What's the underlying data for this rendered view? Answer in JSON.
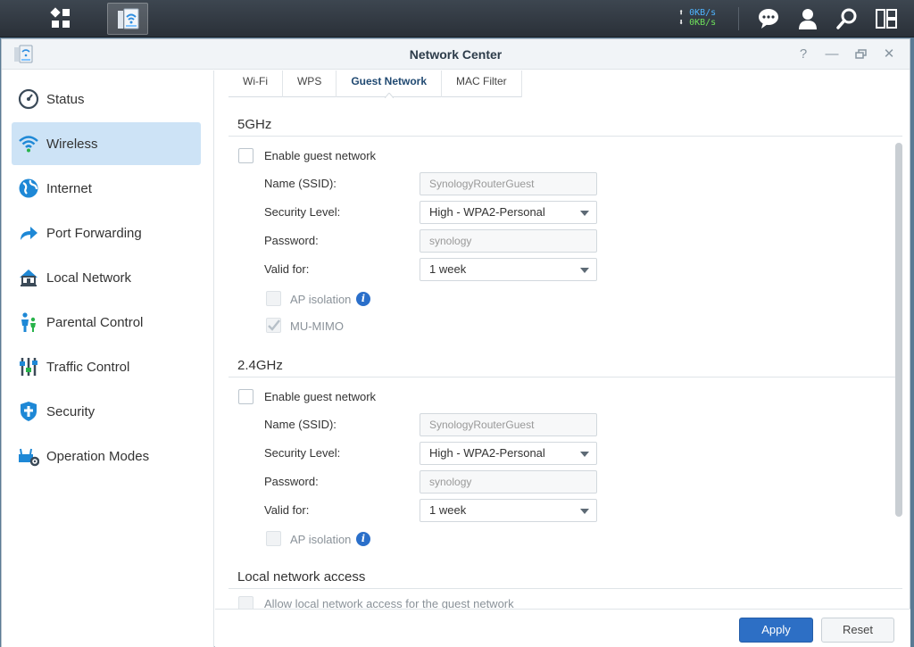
{
  "taskbar": {
    "upload_speed": "0KB/s",
    "download_speed": "0KB/s",
    "icons": [
      "main-menu-icon",
      "network-center-app-icon",
      "chat-icon",
      "user-icon",
      "search-icon",
      "widgets-icon"
    ]
  },
  "window": {
    "title": "Network Center",
    "controls": [
      "help-icon",
      "minimize-icon",
      "restore-icon",
      "close-icon"
    ]
  },
  "sidebar": {
    "items": [
      {
        "label": "Status",
        "icon": "gauge-icon"
      },
      {
        "label": "Wireless",
        "icon": "wifi-icon",
        "active": true
      },
      {
        "label": "Internet",
        "icon": "globe-icon"
      },
      {
        "label": "Port Forwarding",
        "icon": "arrow-forward-icon"
      },
      {
        "label": "Local Network",
        "icon": "home-network-icon"
      },
      {
        "label": "Parental Control",
        "icon": "family-icon"
      },
      {
        "label": "Traffic Control",
        "icon": "sliders-icon"
      },
      {
        "label": "Security",
        "icon": "shield-icon"
      },
      {
        "label": "Operation Modes",
        "icon": "router-gear-icon"
      }
    ]
  },
  "tabs": [
    {
      "label": "Wi-Fi"
    },
    {
      "label": "WPS"
    },
    {
      "label": "Guest Network",
      "active": true
    },
    {
      "label": "MAC Filter"
    }
  ],
  "band5": {
    "title": "5GHz",
    "enable_label": "Enable guest network",
    "name_label": "Name (SSID):",
    "name_value": "SynologyRouterGuest",
    "security_label": "Security Level:",
    "security_value": "High - WPA2-Personal",
    "password_label": "Password:",
    "password_value": "synology",
    "valid_label": "Valid for:",
    "valid_value": "1 week",
    "ap_isolation_label": "AP isolation",
    "mumimo_label": "MU-MIMO"
  },
  "band24": {
    "title": "2.4GHz",
    "enable_label": "Enable guest network",
    "name_label": "Name (SSID):",
    "name_value": "SynologyRouterGuest",
    "security_label": "Security Level:",
    "security_value": "High - WPA2-Personal",
    "password_label": "Password:",
    "password_value": "synology",
    "valid_label": "Valid for:",
    "valid_value": "1 week",
    "ap_isolation_label": "AP isolation"
  },
  "local_access": {
    "title": "Local network access",
    "allow_label": "Allow local network access for the guest network"
  },
  "footer": {
    "apply_label": "Apply",
    "reset_label": "Reset"
  },
  "colors": {
    "accent": "#2d6fc5",
    "active_nav": "#cde3f6",
    "taskbar": "#2f363e"
  }
}
